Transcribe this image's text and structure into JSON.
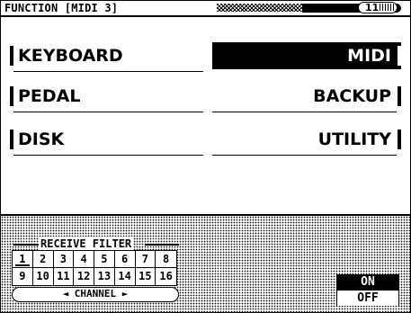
{
  "header": {
    "title": "FUNCTION [MIDI 3]",
    "page_number": "11"
  },
  "menu": {
    "left": [
      {
        "label": "KEYBOARD"
      },
      {
        "label": "PEDAL"
      },
      {
        "label": "DISK"
      }
    ],
    "right": [
      {
        "label": "MIDI",
        "active": true
      },
      {
        "label": "BACKUP",
        "active": false
      },
      {
        "label": "UTILITY",
        "active": false
      }
    ]
  },
  "receive_filter": {
    "label": "RECEIVE FILTER",
    "channels_row1": [
      "1",
      "2",
      "3",
      "4",
      "5",
      "6",
      "7",
      "8"
    ],
    "channels_row2": [
      "9",
      "10",
      "11",
      "12",
      "13",
      "14",
      "15",
      "16"
    ],
    "selected_channel": "1",
    "channel_selector_label": "◄ CHANNEL ►"
  },
  "onoff": {
    "on_label": "ON",
    "off_label": "OFF",
    "selected": "ON"
  },
  "colors": {
    "foreground": "#000000",
    "background": "#ffffff"
  }
}
